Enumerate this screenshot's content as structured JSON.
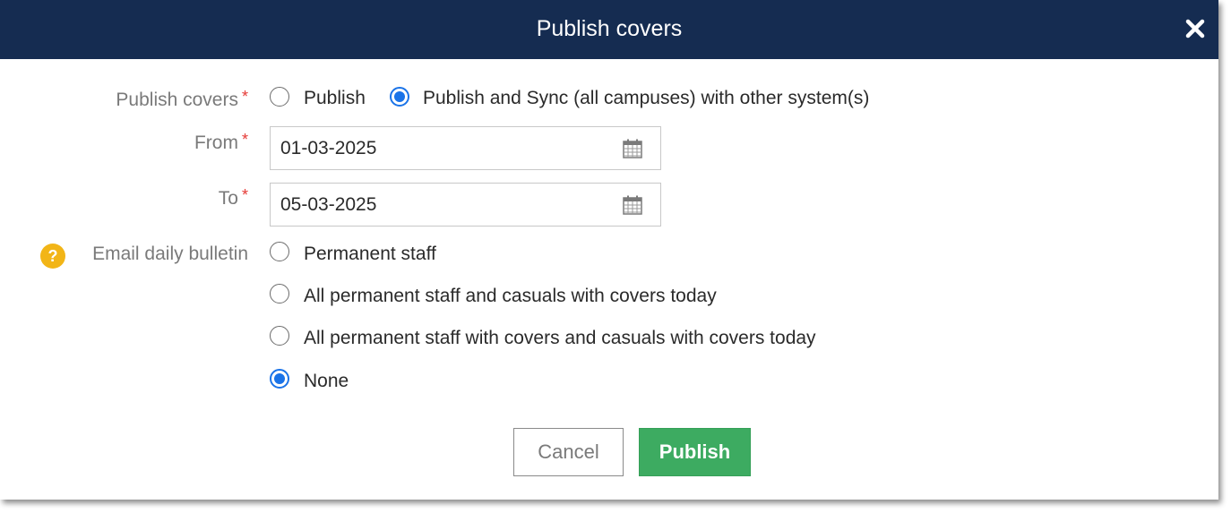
{
  "dialog": {
    "title": "Publish covers",
    "colors": {
      "header_bg": "#152c51",
      "accent": "#1a73e8",
      "primary_button": "#3dab61",
      "required": "#e53935",
      "help": "#f2b517"
    }
  },
  "form": {
    "publish_covers": {
      "label": "Publish covers",
      "required_mark": "*",
      "options": [
        {
          "label": "Publish",
          "checked": false
        },
        {
          "label": "Publish and Sync (all campuses) with other system(s)",
          "checked": true
        }
      ]
    },
    "from": {
      "label": "From",
      "required_mark": "*",
      "value": "01-03-2025",
      "icon": "calendar-icon"
    },
    "to": {
      "label": "To",
      "required_mark": "*",
      "value": "05-03-2025",
      "icon": "calendar-icon"
    },
    "email_bulletin": {
      "label": "Email daily bulletin",
      "help_icon": "question-icon",
      "help_glyph": "?",
      "options": [
        {
          "label": "Permanent staff",
          "checked": false
        },
        {
          "label": "All permanent staff and casuals with covers today",
          "checked": false
        },
        {
          "label": "All permanent staff with covers and casuals with covers today",
          "checked": false
        },
        {
          "label": "None",
          "checked": true
        }
      ]
    }
  },
  "buttons": {
    "cancel": "Cancel",
    "publish": "Publish"
  }
}
